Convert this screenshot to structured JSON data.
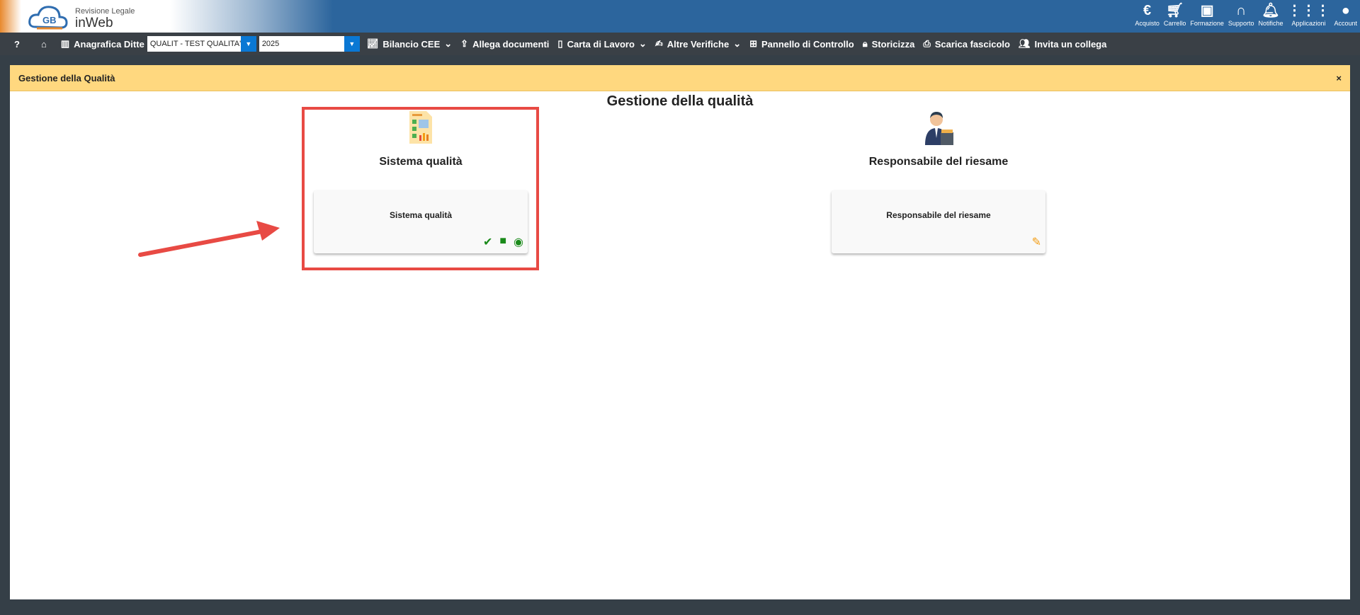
{
  "header": {
    "logo_line1": "Revisione Legale",
    "logo_line2": "inWeb",
    "icons": [
      {
        "label": "Acquisto",
        "icon": "euro-icon"
      },
      {
        "label": "Carrello",
        "icon": "cart-icon"
      },
      {
        "label": "Formazione",
        "icon": "training-icon"
      },
      {
        "label": "Supporto",
        "icon": "headset-icon"
      },
      {
        "label": "Notifiche",
        "icon": "bell-icon"
      },
      {
        "label": "Applicazioni",
        "icon": "grid-icon"
      },
      {
        "label": "Account",
        "icon": "user-icon"
      }
    ]
  },
  "toolbar": {
    "help": "?",
    "anagrafica": "Anagrafica Ditte",
    "company_value": "QUALIT - TEST QUALITA' S",
    "year_value": "2025",
    "bilancio": "Bilancio CEE",
    "allega": "Allega documenti",
    "carta": "Carta di Lavoro",
    "altre": "Altre Verifiche",
    "pannello": "Pannello di Controllo",
    "storicizza": "Storicizza",
    "scarica": "Scarica fascicolo",
    "invita": "Invita un collega"
  },
  "panel": {
    "bar_title": "Gestione della Qualità",
    "close": "×",
    "title": "Gestione della qualità",
    "sections": [
      {
        "heading": "Sistema qualità",
        "card": "Sistema qualità"
      },
      {
        "heading": "Responsabile del riesame",
        "card": "Responsabile del riesame"
      }
    ]
  },
  "colors": {
    "header": "#2c659d",
    "toolbar": "#3a4046",
    "bar": "#ffd87f",
    "highlight": "#e84a44",
    "action_green": "#1a8a1a",
    "edit_orange": "#f39c12"
  }
}
